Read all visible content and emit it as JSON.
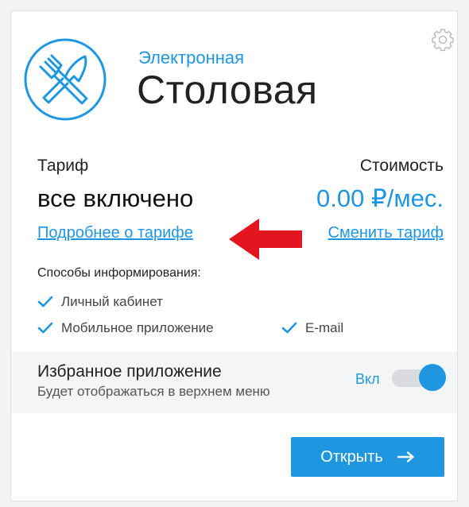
{
  "brand": {
    "subtitle": "Электронная",
    "title": "Столовая"
  },
  "tariff": {
    "label": "Тариф",
    "value": "все включено",
    "details_link": "Подробнее о тарифе"
  },
  "cost": {
    "label": "Стоимость",
    "value": "0.00 ₽/мес.",
    "change_link": "Сменить тариф"
  },
  "notifications": {
    "title": "Способы информирования:",
    "items": [
      "Личный кабинет",
      "Мобильное приложение",
      "E-mail"
    ]
  },
  "favorite": {
    "title": "Избранное приложение",
    "subtitle": "Будет отображаться в верхнем меню",
    "state_label": "Вкл",
    "enabled": true
  },
  "actions": {
    "open_label": "Открыть"
  },
  "colors": {
    "accent": "#1f97e0",
    "annotation_arrow": "#e3151e"
  },
  "icons": [
    "gear-icon",
    "fork-knife-icon",
    "check-icon",
    "arrow-right-icon",
    "red-arrow-annotation"
  ]
}
